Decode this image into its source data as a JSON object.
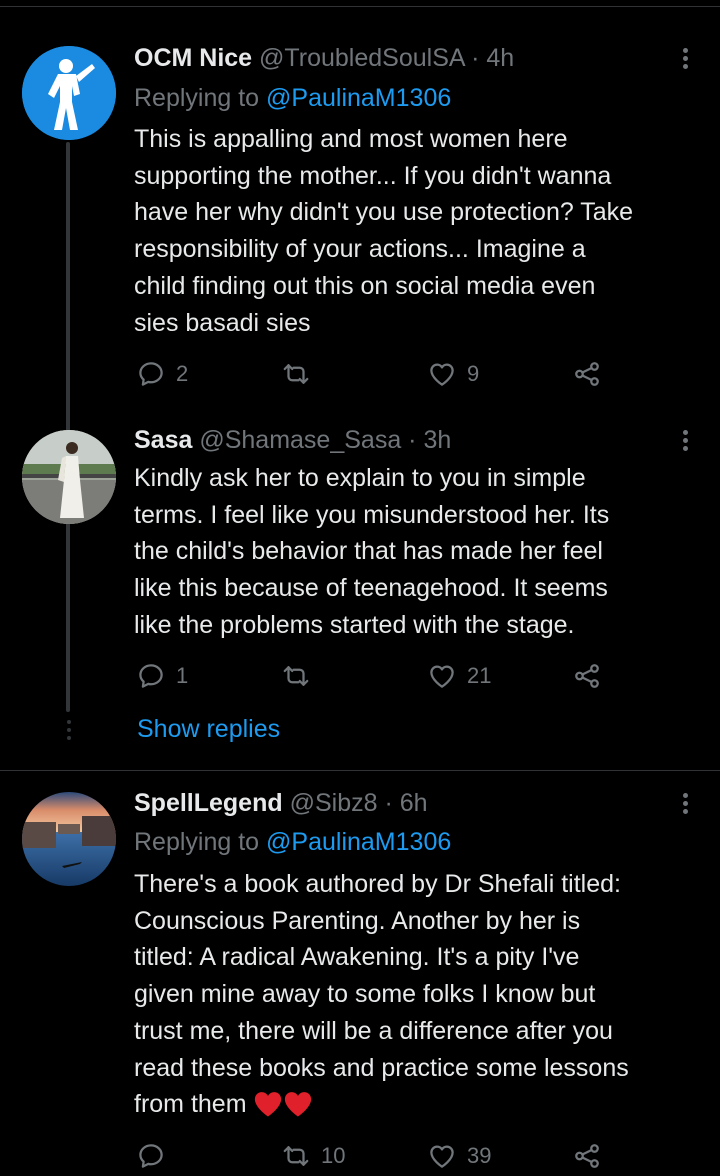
{
  "tweets": [
    {
      "name": "OCM Nice",
      "handle": "@TroubledSoulSA",
      "time": "4h",
      "replying_prefix": "Replying to ",
      "replying_to": "@PaulinaM1306",
      "text_lines": [
        "This is appalling and most women here",
        "supporting the mother... If you didn't wanna",
        "have her why didn't you use protection? Take",
        "responsibility of your actions... Imagine a",
        "child finding out this on social media even",
        "sies basadi sies"
      ],
      "replies": "2",
      "retweets": "",
      "likes": "9"
    },
    {
      "name": "Sasa",
      "handle": "@Shamase_Sasa",
      "time": "3h",
      "text_lines": [
        "Kindly ask her to explain to you in simple",
        "terms. I feel like you misunderstood her. Its",
        "the child's behavior that has made her feel",
        "like this because of teenagehood. It seems",
        "like the problems started with the stage."
      ],
      "replies": "1",
      "retweets": "",
      "likes": "21"
    },
    {
      "name": "SpellLegend",
      "handle": "@Sibz8",
      "time": "6h",
      "replying_prefix": "Replying to ",
      "replying_to": "@PaulinaM1306",
      "text_lines": [
        "There's a book authored by Dr Shefali titled:",
        "Counscious Parenting. Another by her is",
        "titled: A radical Awakening. It's a pity I've",
        "given mine away to some folks I know but",
        "trust me, there will be a difference after you",
        "read these books and practice some lessons",
        "from them"
      ],
      "replies": "",
      "retweets": "10",
      "likes": "39"
    }
  ],
  "show_replies": "Show replies",
  "separator": " · ",
  "colors": {
    "background": "#000000",
    "accent": "#1d9bf0",
    "muted": "#71767b",
    "heart": "#f91880"
  }
}
